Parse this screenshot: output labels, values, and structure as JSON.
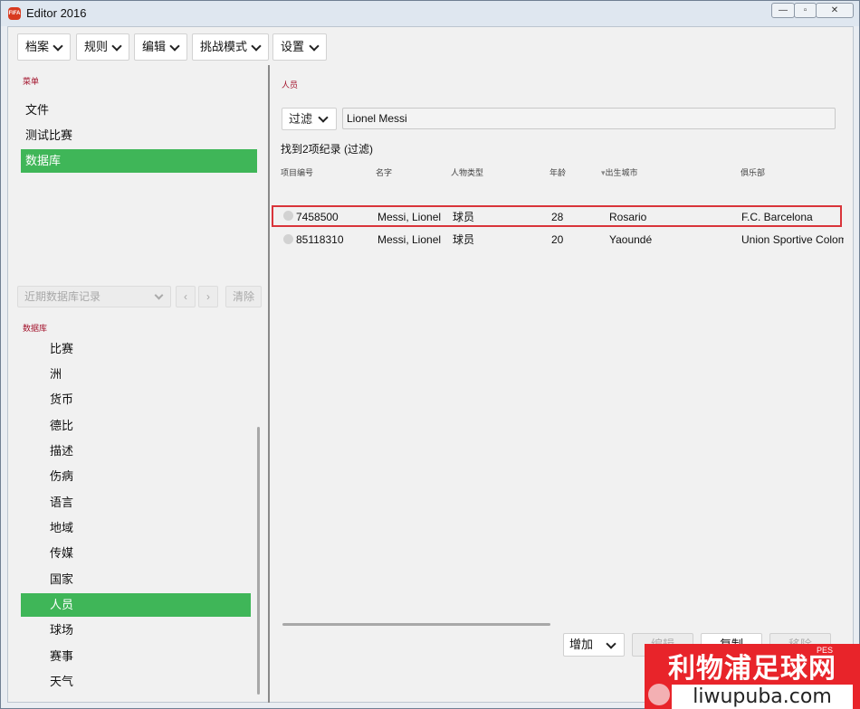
{
  "window": {
    "title": "Editor 2016",
    "app_icon_text": "FIFA",
    "controls": {
      "minimize": "—",
      "maximize": "▫",
      "close": "✕"
    }
  },
  "menubar": [
    "档案",
    "规则",
    "编辑",
    "挑战模式",
    "设置"
  ],
  "left": {
    "menu_label": "菜单",
    "menu_items": [
      "文件",
      "测试比赛",
      "数据库"
    ],
    "active_menu": "数据库",
    "recent": {
      "placeholder": "近期数据库记录",
      "clear": "清除"
    },
    "db_label": "数据库",
    "db_items": [
      "比赛",
      "洲",
      "货币",
      "德比",
      "描述",
      "伤病",
      "语言",
      "地域",
      "传媒",
      "国家",
      "人员",
      "球场",
      "赛事",
      "天气"
    ],
    "active_db": "人员"
  },
  "right": {
    "section_label": "人员",
    "filter": {
      "mode": "过滤",
      "query": "Lionel Messi"
    },
    "found_text": "找到2项纪录 (过滤)",
    "columns": [
      "项目编号",
      "名字",
      "人物类型",
      "年龄",
      "出生城市",
      "俱乐部"
    ],
    "rows": [
      {
        "id": "7458500",
        "name": "Messi, Lionel",
        "type": "球员",
        "age": "28",
        "city": "Rosario",
        "club": "F.C. Barcelona"
      },
      {
        "id": "85118310",
        "name": "Messi, Lionel",
        "type": "球员",
        "age": "20",
        "city": "Yaoundé",
        "club": "Union Sportive Colom"
      }
    ],
    "actions": {
      "add": "增加",
      "edit": "编辑",
      "copy": "复制",
      "delete": "移除"
    }
  },
  "watermark": {
    "title": "利物浦足球网",
    "url": "liwupuba.com",
    "corner": "PES"
  },
  "colors": {
    "accent_green": "#3fb658",
    "section_label_red": "#a3132c",
    "selection_border": "#d9343a",
    "watermark_red": "#e8242a"
  }
}
